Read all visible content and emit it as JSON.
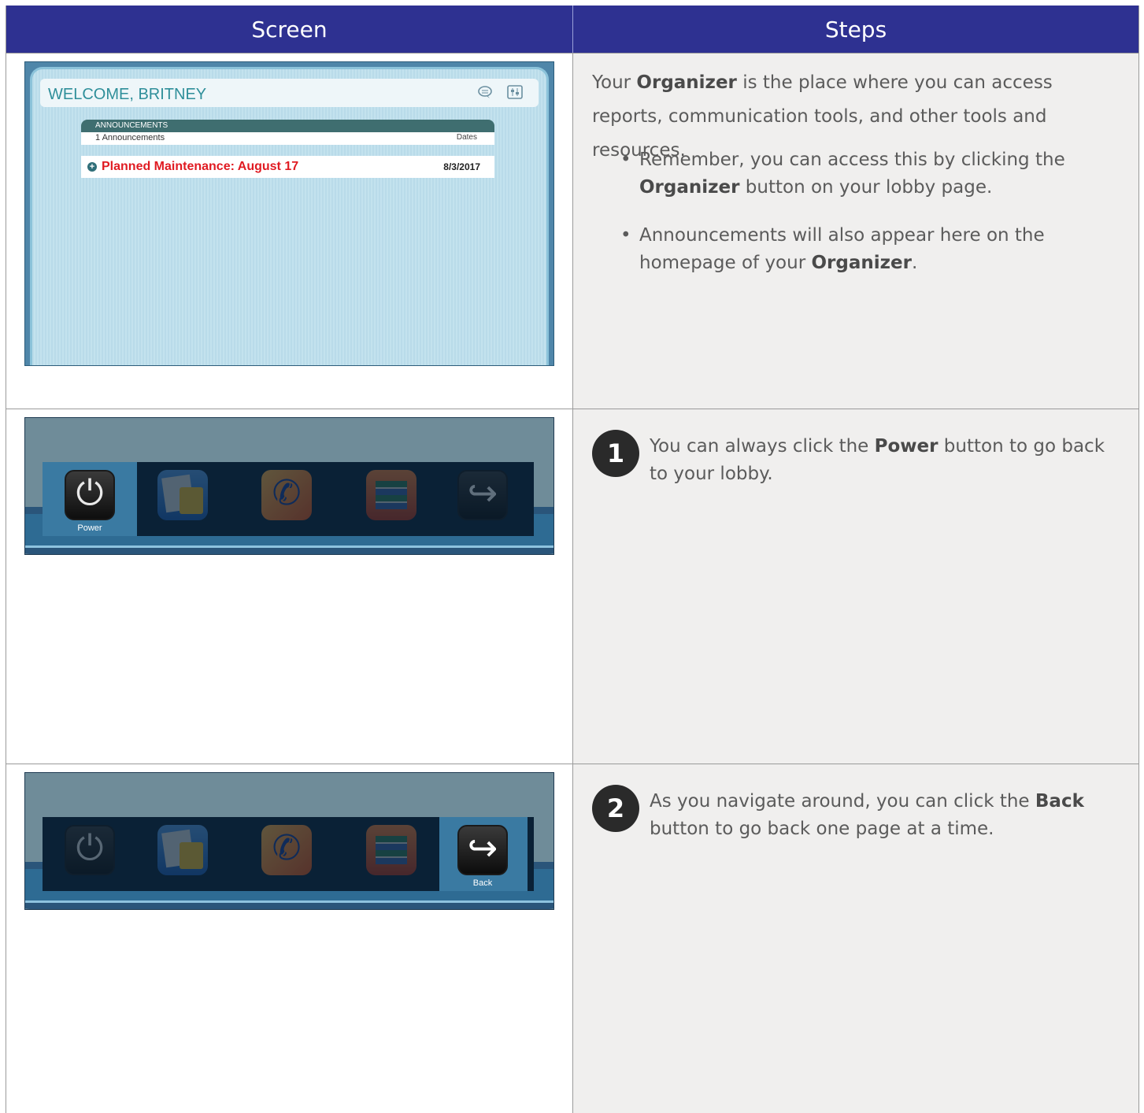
{
  "header": {
    "screen": "Screen",
    "steps": "Steps"
  },
  "row1": {
    "screenshot": {
      "welcome": "WELCOME, BRITNEY",
      "icons": [
        "chat-icon",
        "settings-icon"
      ],
      "announcements_title": "ANNOUNCEMENTS",
      "announcements_count": "1 Announcements",
      "dates_label": "Dates",
      "item_title": "Planned Maintenance: August 17",
      "item_date": "8/3/2017"
    },
    "intro": {
      "p1": "Your ",
      "b1": "Organizer",
      "p2": " is the place where you can access reports, communication tools, and other tools and resources."
    },
    "bullet1": {
      "p1": "Remember, you can access this by clicking the ",
      "b1": "Organizer",
      "p2": " button on your lobby page."
    },
    "bullet2": {
      "p1": "Announcements will also appear here on the homepage of your ",
      "b1": "Organizer",
      "p2": "."
    }
  },
  "toolbar": {
    "power_label": "Power",
    "back_label": "Back",
    "icons": [
      "power-icon",
      "reports-icon",
      "communication-icon",
      "resources-icon",
      "back-icon"
    ]
  },
  "step1": {
    "number": "1",
    "p1": "You can always click the ",
    "b1": "Power",
    "p2": " button to go back to your lobby."
  },
  "step2": {
    "number": "2",
    "p1": "As you navigate around, you can click the ",
    "b1": "Back",
    "p2": " button to go back one page at a time."
  },
  "colors": {
    "header_bg": "#2e3191",
    "steps_bg": "#f0efee",
    "announcement_red": "#e01b22"
  }
}
